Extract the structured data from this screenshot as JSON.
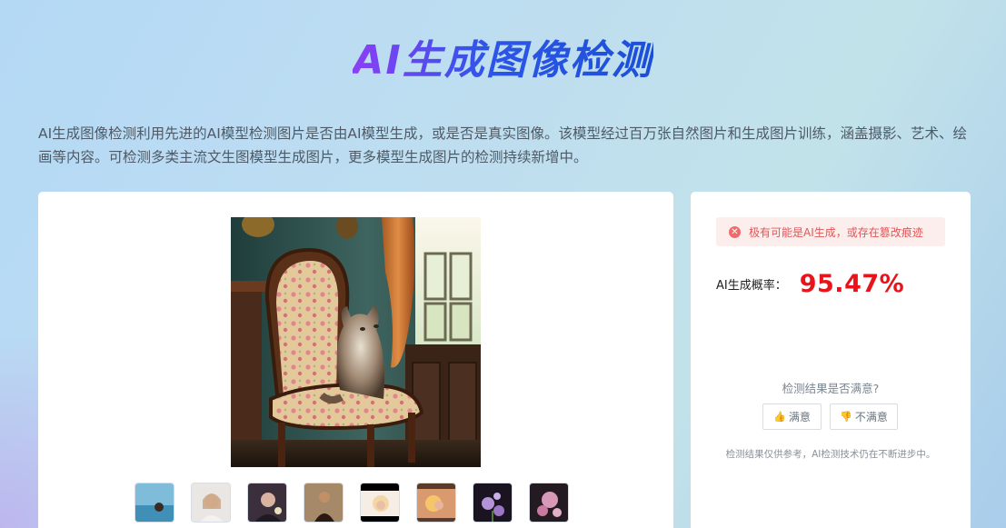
{
  "page": {
    "title": "AI生成图像检测",
    "description": "AI生成图像检测利用先进的AI模型检测图片是否由AI模型生成，或是否是真实图像。该模型经过百万张自然图片和生成图片训练，涵盖摄影、艺术、绘画等内容。可检测多类主流文生图模型生成图片，更多模型生成图片的检测持续新增中。"
  },
  "result": {
    "alert_text": "极有可能是AI生成，或存在篡改痕迹",
    "prob_label": "AI生成概率：",
    "prob_value": "95.47%",
    "feedback_question": "检测结果是否满意?",
    "satisfied_label": "满意",
    "unsatisfied_label": "不满意",
    "note": "检测结果仅供参考，AI检测技术仍在不断进步中。"
  },
  "colors": {
    "title_gradient": [
      "#8b3ff5",
      "#1c4fd8"
    ],
    "alert_bg": "#fdeeee",
    "alert_text": "#e05757",
    "prob_value": "#e8141a"
  },
  "icons": [
    "close-circle-icon",
    "thumbs-up-icon",
    "thumbs-down-icon"
  ]
}
